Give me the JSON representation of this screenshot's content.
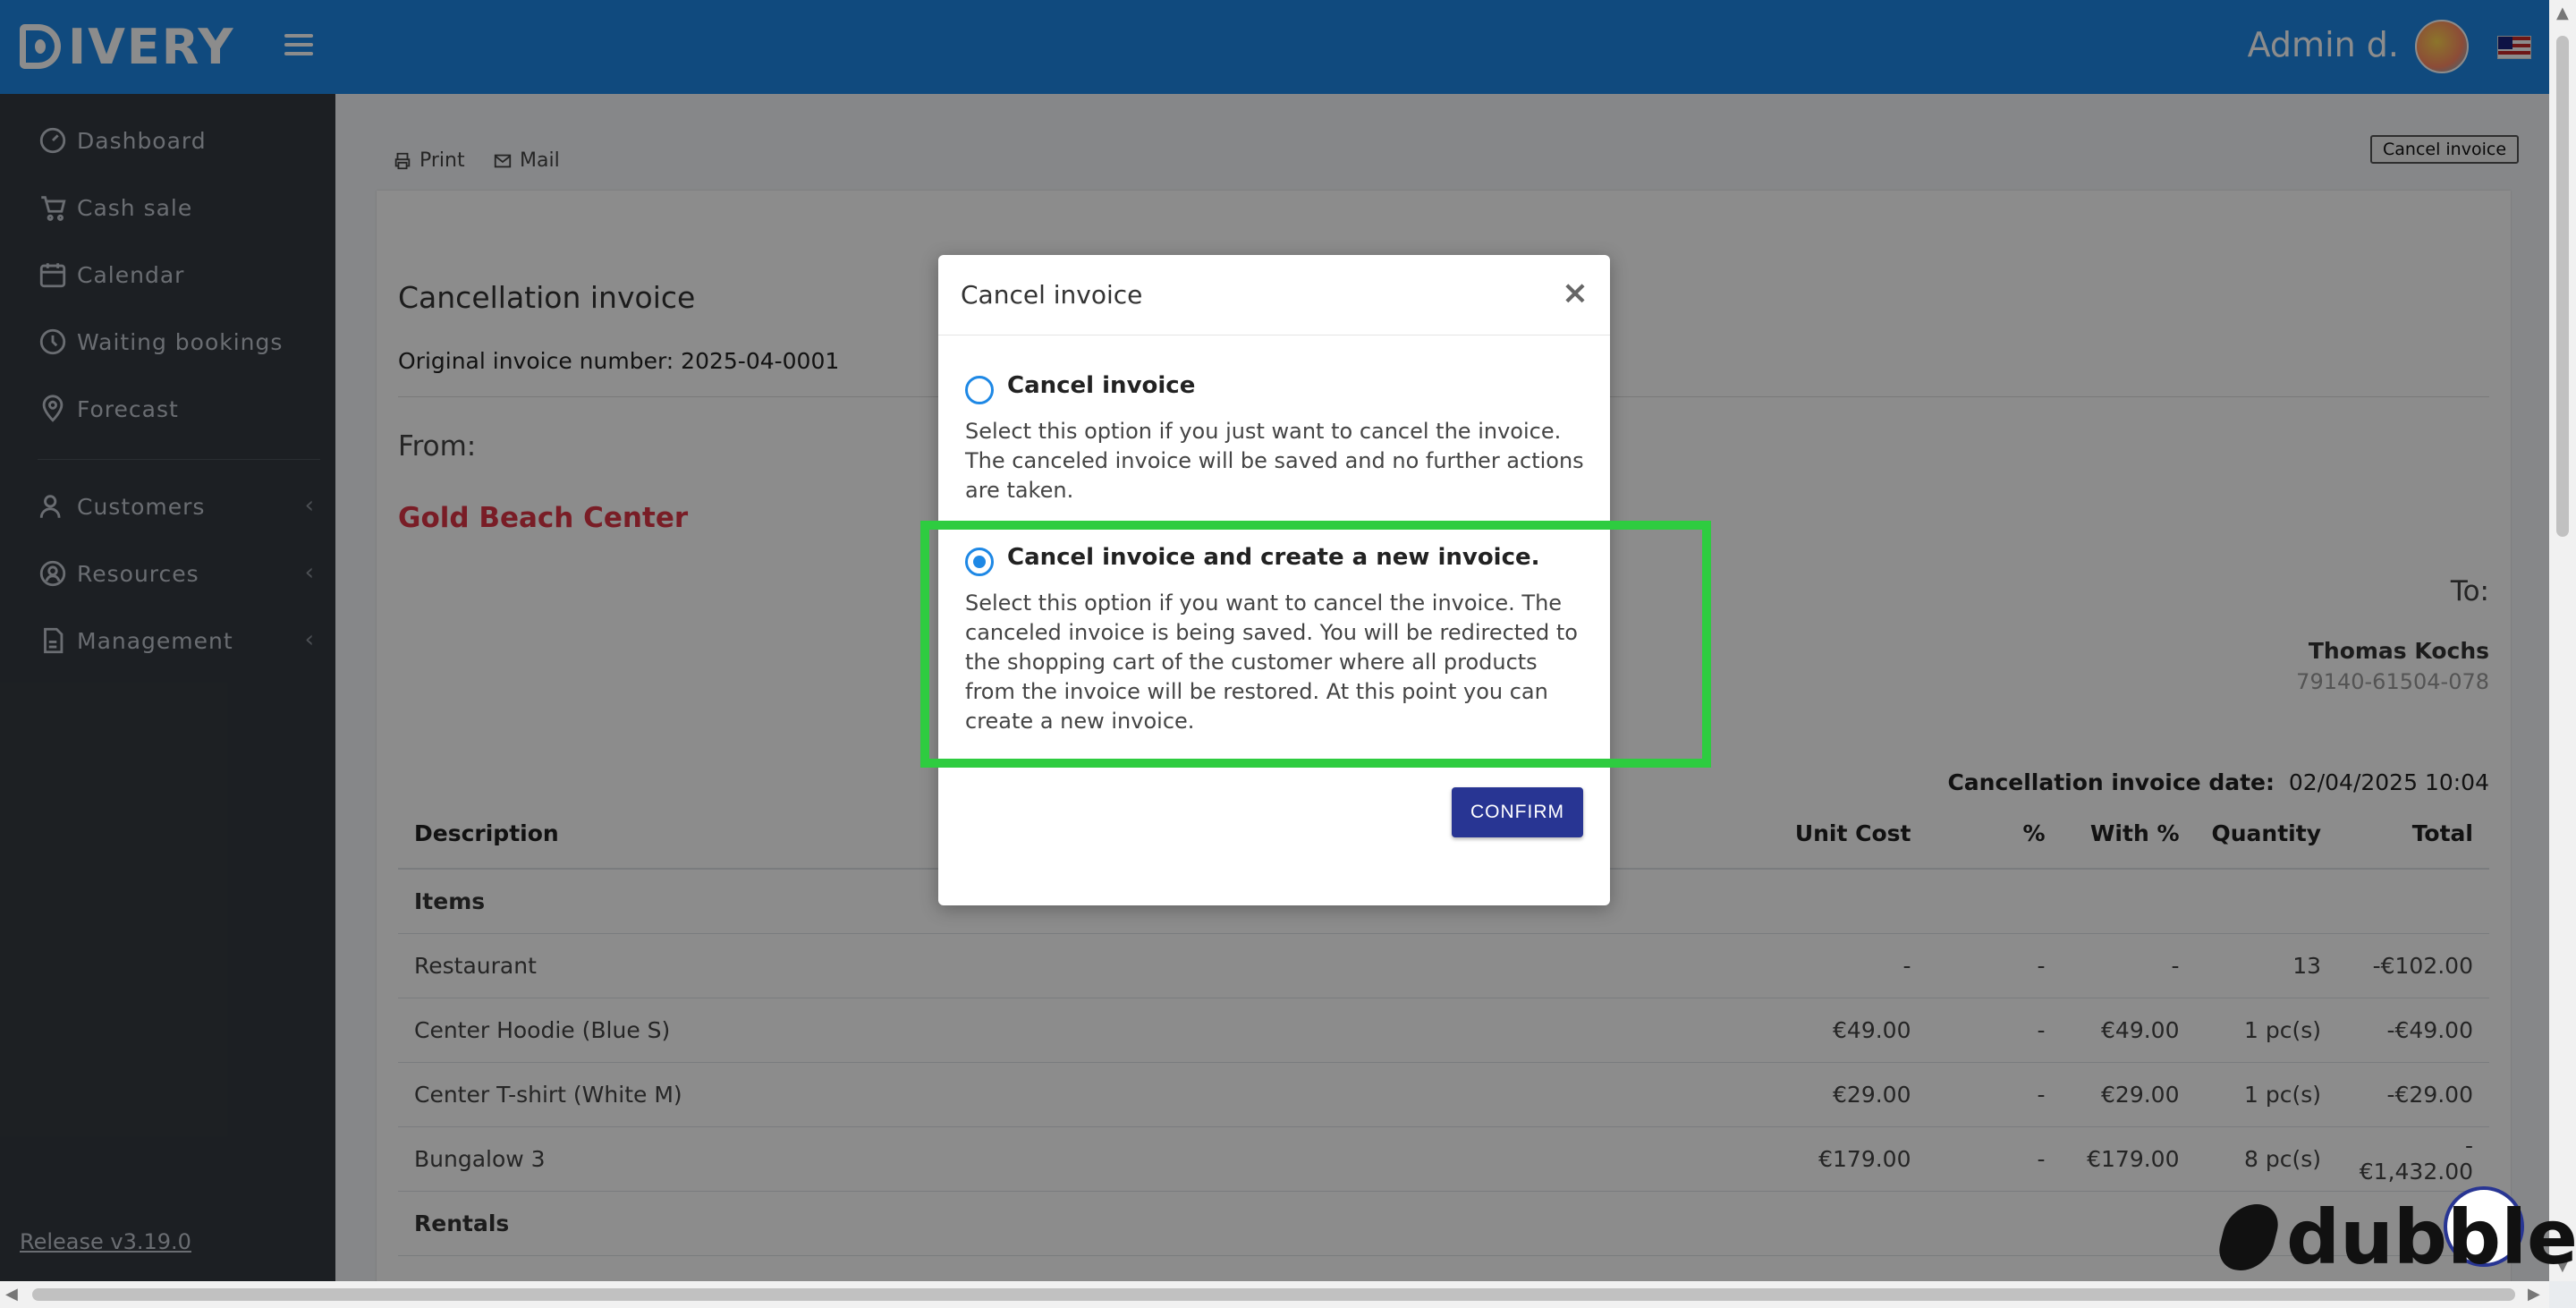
{
  "header": {
    "logo_text": "IVERY",
    "user_name": "Admin d.",
    "language_flag": "us-flag-icon",
    "brand_color": "#1e88e5"
  },
  "sidebar": {
    "items": [
      {
        "label": "Dashboard",
        "icon": "speedometer-icon"
      },
      {
        "label": "Cash sale",
        "icon": "cart-icon"
      },
      {
        "label": "Calendar",
        "icon": "calendar-icon"
      },
      {
        "label": "Waiting bookings",
        "icon": "clock-icon"
      },
      {
        "label": "Forecast",
        "icon": "location-icon"
      },
      {
        "label": "Customers",
        "icon": "users-icon"
      },
      {
        "label": "Resources",
        "icon": "resources-icon"
      },
      {
        "label": "Management",
        "icon": "document-icon"
      }
    ],
    "release": "Release v3.19.0"
  },
  "toolbar": {
    "print_label": "Print",
    "mail_label": "Mail",
    "cancel_invoice_label": "Cancel invoice"
  },
  "invoice": {
    "title": "Cancellation invoice",
    "original_number": "Original invoice number: 2025-04-0001",
    "from_label": "From:",
    "company": "Gold Beach Center",
    "to_label": "To:",
    "customer_name": "Thomas Kochs",
    "customer_number": "79140-61504-078",
    "date_label": "Cancellation invoice date:",
    "date_value": "02/04/2025 10:04",
    "columns": [
      "Description",
      "Unit Cost",
      "%",
      "With %",
      "Quantity",
      "Total"
    ],
    "group_items": "Items",
    "rows": [
      {
        "description": "Restaurant",
        "unit_cost": "-",
        "pct": "-",
        "with_pct": "-",
        "quantity": "13",
        "total": "-€102.00"
      },
      {
        "description": "Center Hoodie (Blue S)",
        "unit_cost": "€49.00",
        "pct": "-",
        "with_pct": "€49.00",
        "quantity": "1 pc(s)",
        "total": "-€49.00"
      },
      {
        "description": "Center T-shirt (White M)",
        "unit_cost": "€29.00",
        "pct": "-",
        "with_pct": "€29.00",
        "quantity": "1 pc(s)",
        "total": "-€29.00"
      },
      {
        "description": "Bungalow 3",
        "unit_cost": "€179.00",
        "pct": "-",
        "with_pct": "€179.00",
        "quantity": "8 pc(s)",
        "total": "-€1,432.00"
      }
    ],
    "group_rentals": "Rentals"
  },
  "modal": {
    "title": "Cancel invoice",
    "close_symbol": "×",
    "option1": {
      "label": "Cancel invoice",
      "description": "Select this option if you just want to cancel the invoice. The canceled invoice will be saved and no further actions are taken.",
      "checked": false
    },
    "option2": {
      "label": "Cancel invoice and create a new invoice.",
      "description": "Select this option if you want to cancel the invoice. The canceled invoice is being saved. You will be redirected to the shopping cart of the customer where all products from the invoice will be restored. At this point you can create a new invoice.",
      "checked": true
    },
    "confirm_label": "CONFIRM",
    "confirm_color": "#283593",
    "highlight_color": "#2ecc40"
  },
  "watermark": {
    "text": "dubble"
  }
}
